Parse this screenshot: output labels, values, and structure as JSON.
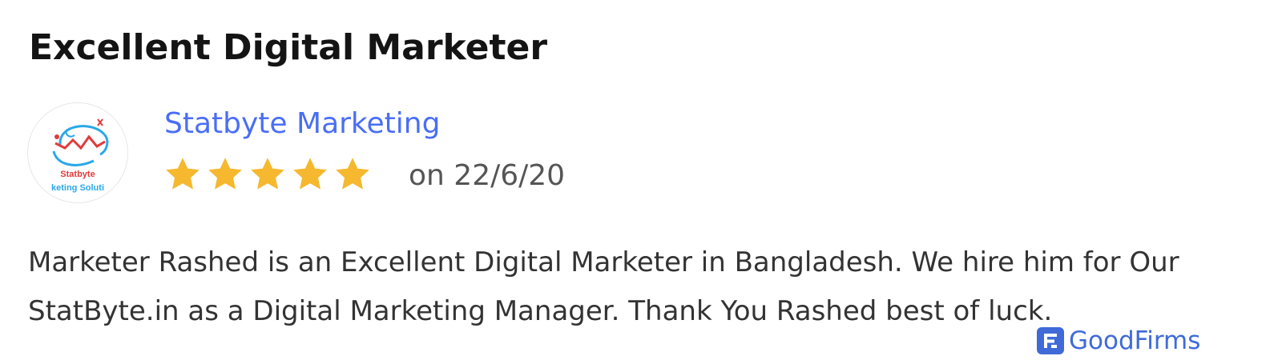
{
  "review": {
    "title": "Excellent Digital Marketer",
    "reviewer_name": "Statbyte Marketing",
    "rating": 5,
    "rating_max": 5,
    "date_text": "on 22/6/20",
    "body": "Marketer Rashed is an Excellent Digital Marketer in Bangladesh. We hire him for Our StatByte.in as a Digital Marketing Manager. Thank You Rashed best of luck."
  },
  "avatar": {
    "icon": "statbyte-logo",
    "logo_text": [
      "Statbyte",
      "keting Soluti"
    ],
    "colors": {
      "red": "#e23b3b",
      "blue": "#2aa8e8"
    }
  },
  "source": {
    "icon": "goodfirms-logo-icon",
    "name": "GoodFirms"
  },
  "colors": {
    "title": "#141414",
    "reviewer_link": "#4a6ef5",
    "star": "#f5b82e",
    "date": "#555555",
    "body_text": "#333333",
    "source": "#3f6ad8"
  }
}
